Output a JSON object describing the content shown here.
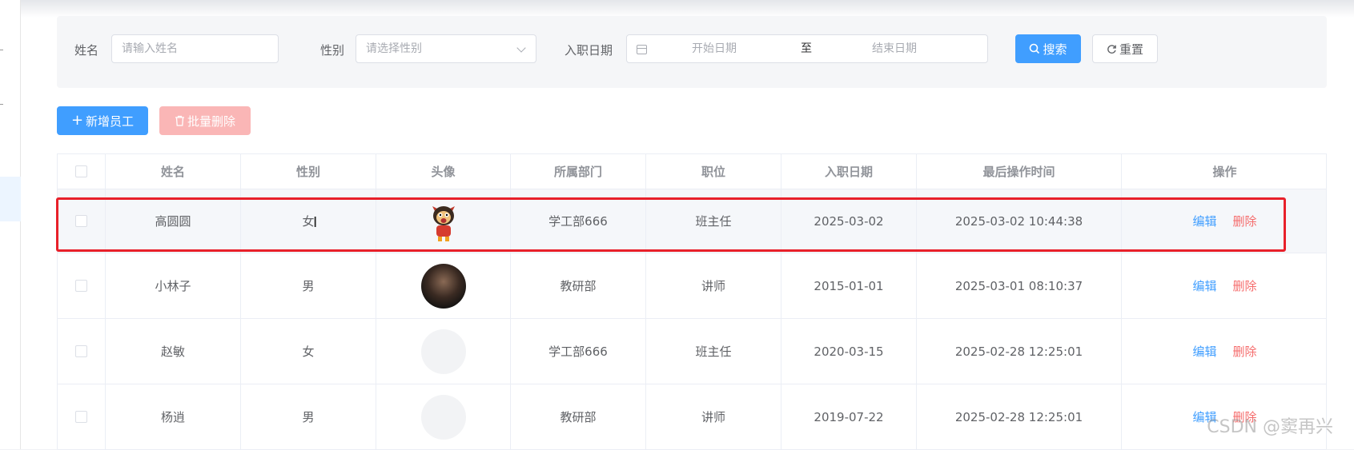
{
  "search": {
    "name_label": "姓名",
    "name_placeholder": "请输入姓名",
    "gender_label": "性别",
    "gender_placeholder": "请选择性别",
    "date_label": "入职日期",
    "start_placeholder": "开始日期",
    "range_separator": "至",
    "end_placeholder": "结束日期",
    "search_button": "搜索",
    "reset_button": "重置"
  },
  "toolbar": {
    "add_button": "新增员工",
    "batch_delete_button": "批量删除"
  },
  "table": {
    "columns": [
      "姓名",
      "性别",
      "头像",
      "所属部门",
      "职位",
      "入职日期",
      "最后操作时间",
      "操作"
    ],
    "rows": [
      {
        "name": "高圆圆",
        "gender": "女",
        "avatar": "cartoon-mascot",
        "dept": "学工部666",
        "position": "班主任",
        "entry_date": "2025-03-02",
        "updated": "2025-03-02 10:44:38"
      },
      {
        "name": "小林子",
        "gender": "男",
        "avatar": "photo",
        "dept": "教研部",
        "position": "讲师",
        "entry_date": "2015-01-01",
        "updated": "2025-03-01 08:10:37"
      },
      {
        "name": "赵敏",
        "gender": "女",
        "avatar": "empty",
        "dept": "学工部666",
        "position": "班主任",
        "entry_date": "2020-03-15",
        "updated": "2025-02-28 12:25:01"
      },
      {
        "name": "杨逍",
        "gender": "男",
        "avatar": "empty",
        "dept": "教研部",
        "position": "讲师",
        "entry_date": "2019-07-22",
        "updated": "2025-02-28 12:25:01"
      }
    ],
    "edit_label": "编辑",
    "delete_label": "删除"
  },
  "watermark": "CSDN @窦再兴",
  "colors": {
    "primary": "#409eff",
    "danger": "#f56c6c",
    "danger_disabled": "#fab6b6",
    "highlight": "#e8202a"
  }
}
